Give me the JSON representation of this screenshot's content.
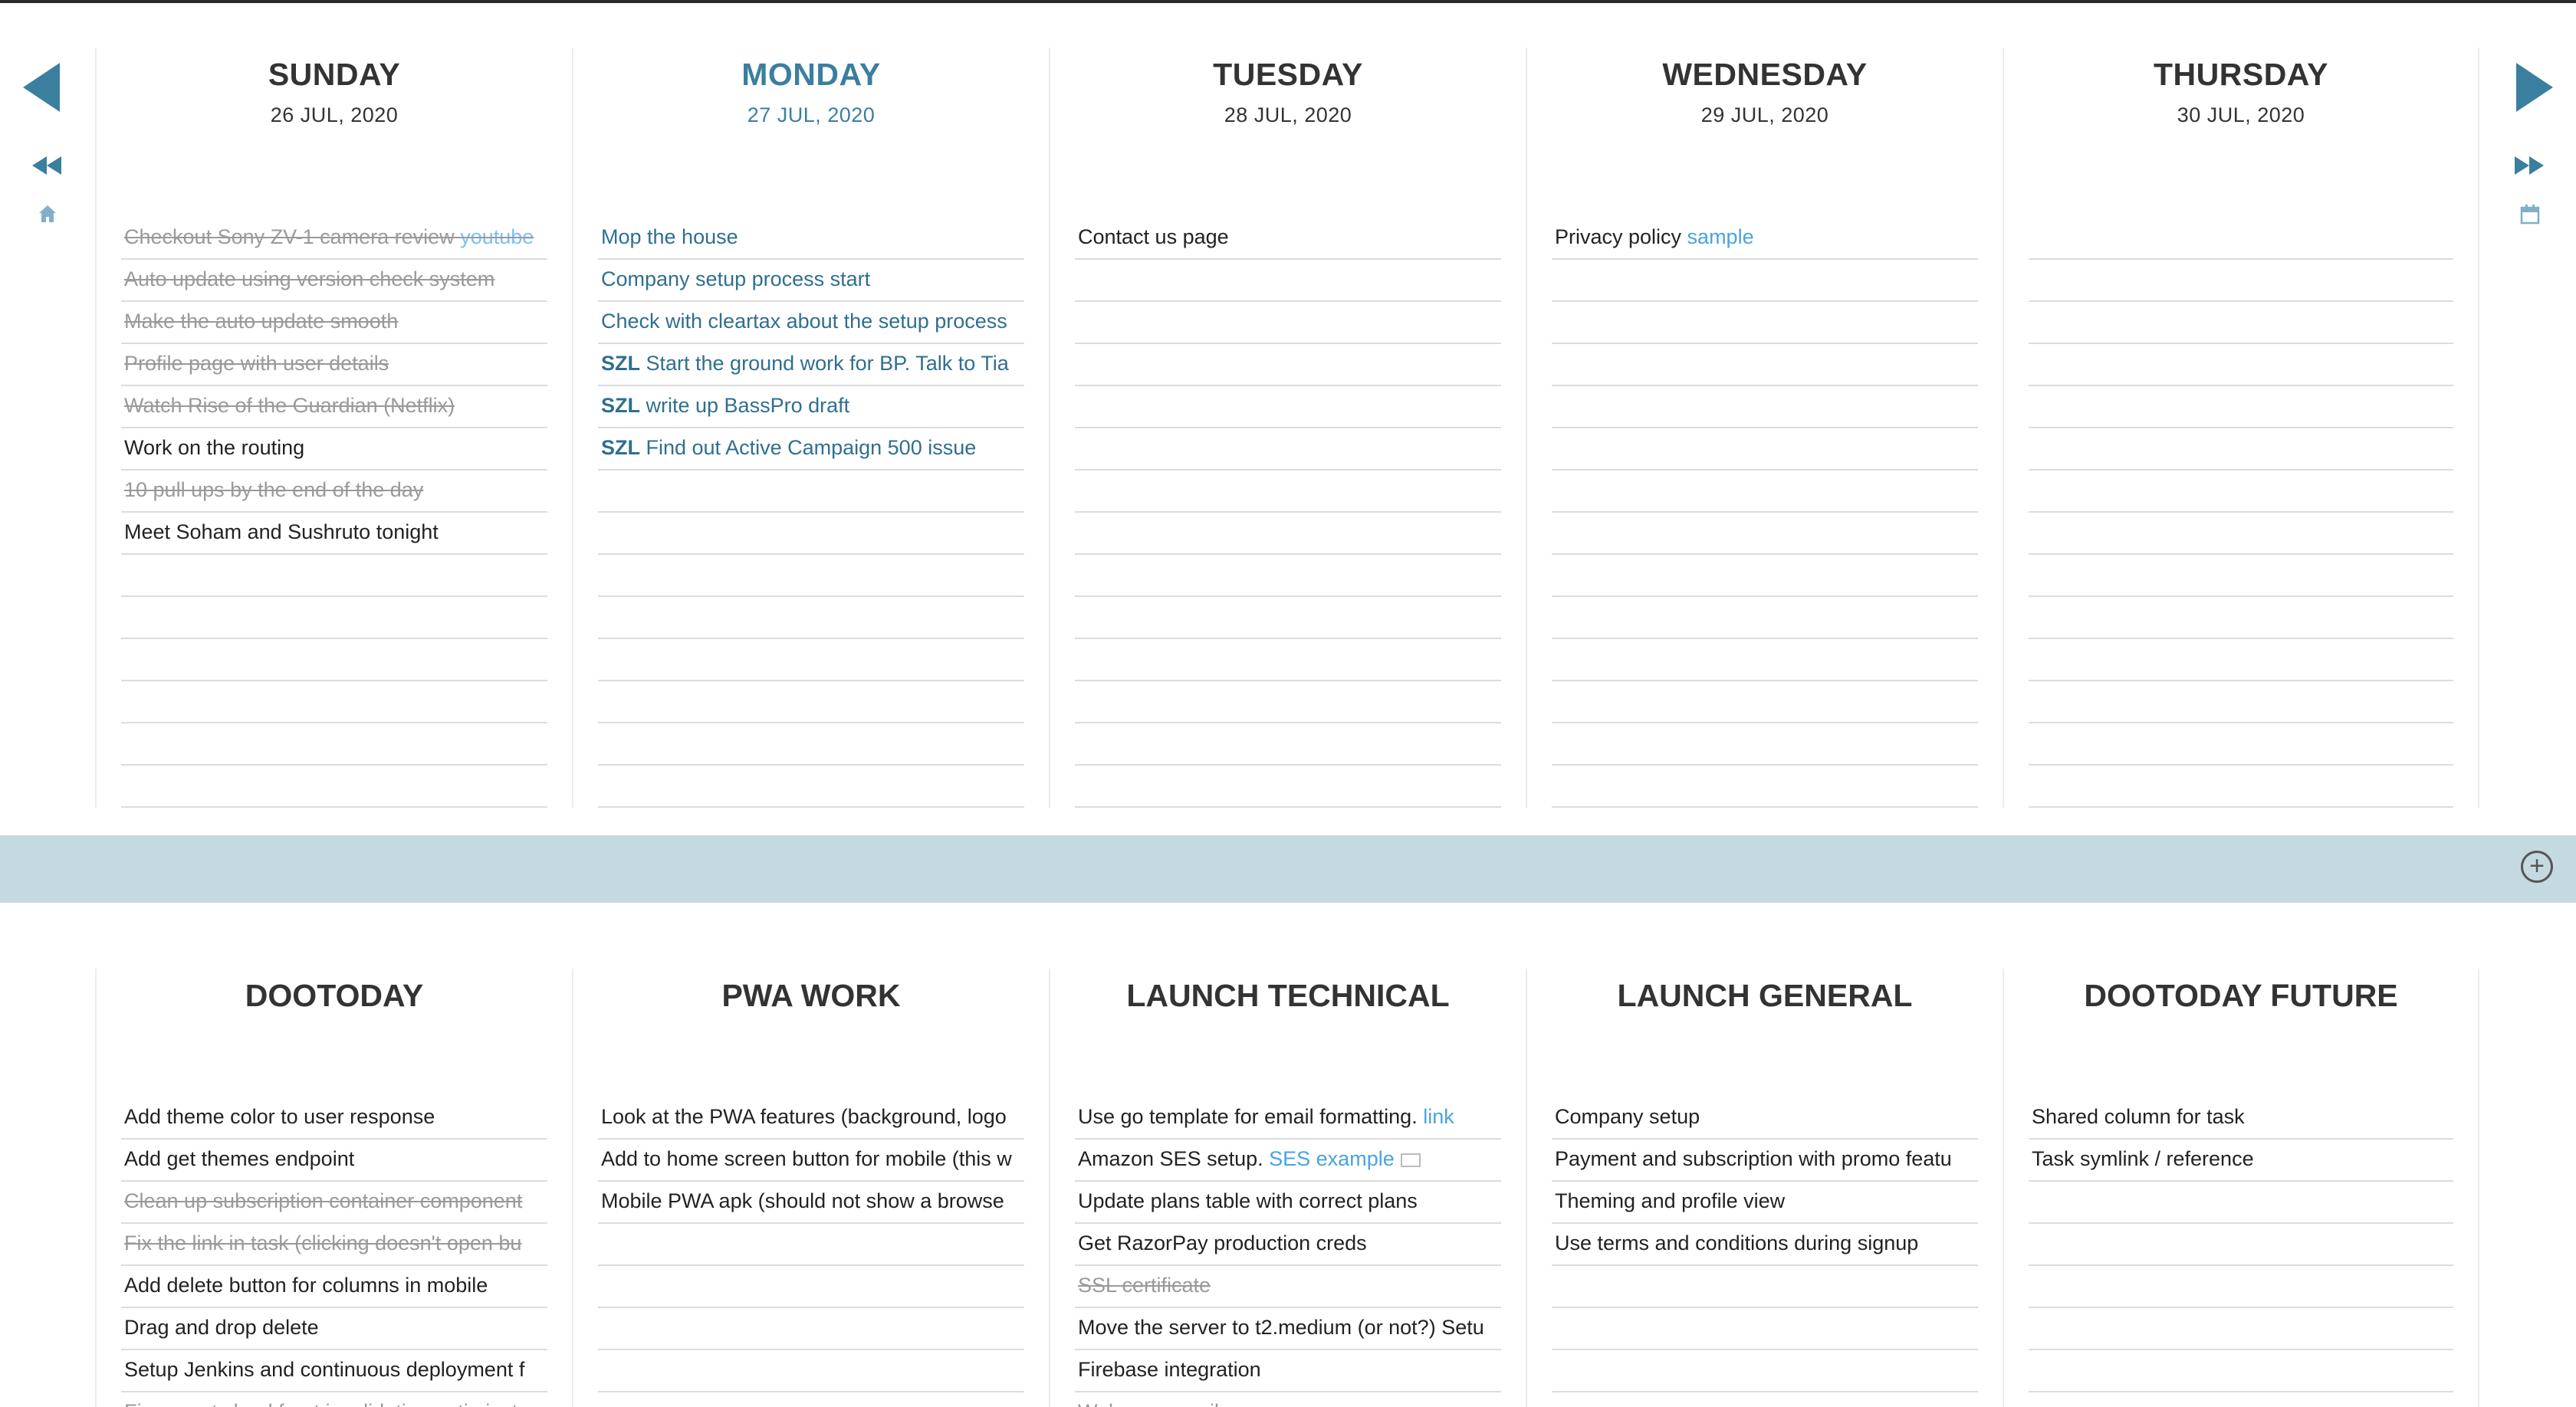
{
  "colors": {
    "accent": "#3a7fa0",
    "band": "#c5d9e0",
    "link": "#4aa3df"
  },
  "nav": {
    "prev_icon": "triangle-left-icon",
    "next_icon": "triangle-right-icon",
    "rewind_icon": "double-chevron-left-icon",
    "fastforward_icon": "double-chevron-right-icon",
    "home_icon": "home-icon",
    "calendar_icon": "calendar-icon"
  },
  "days": [
    {
      "name": "SUNDAY",
      "date": "26 JUL, 2020",
      "today": false,
      "tasks": [
        {
          "text": "Checkout Sony ZV-1 camera review ",
          "link": "youtube",
          "done": true
        },
        {
          "text": "Auto update using version check system",
          "done": true
        },
        {
          "text": "Make the auto update smooth",
          "done": true
        },
        {
          "text": "Profile page with user details",
          "done": true
        },
        {
          "text": "Watch Rise of the Guardian (Netflix)",
          "done": true
        },
        {
          "text": "Work on the routing",
          "done": false
        },
        {
          "text": "10 pull ups by the end of the day",
          "done": true
        },
        {
          "text": "Meet Soham and Sushruto tonight",
          "done": false
        }
      ]
    },
    {
      "name": "MONDAY",
      "date": "27 JUL, 2020",
      "today": true,
      "tasks": [
        {
          "text": "Mop the house",
          "done": false
        },
        {
          "text": "Company setup process start",
          "done": false
        },
        {
          "text": "Check with cleartax about the setup process",
          "done": false
        },
        {
          "prefix": "SZL",
          "text": " Start the ground work for BP. Talk to Tia",
          "done": false
        },
        {
          "prefix": "SZL",
          "text": " write up BassPro draft",
          "done": false
        },
        {
          "prefix": "SZL",
          "text": " Find out Active Campaign 500 issue",
          "done": false
        }
      ]
    },
    {
      "name": "TUESDAY",
      "date": "28 JUL, 2020",
      "today": false,
      "tasks": [
        {
          "text": "Contact us page",
          "done": false
        }
      ]
    },
    {
      "name": "WEDNESDAY",
      "date": "29 JUL, 2020",
      "today": false,
      "tasks": [
        {
          "text": "Privacy policy ",
          "link": "sample",
          "done": false
        }
      ]
    },
    {
      "name": "THURSDAY",
      "date": "30 JUL, 2020",
      "today": false,
      "tasks": []
    }
  ],
  "band": {
    "add_icon": "plus-circle-icon"
  },
  "lists": [
    {
      "name": "DOOTODAY",
      "tasks": [
        {
          "text": "Add theme color to user response",
          "done": false
        },
        {
          "text": "Add get themes endpoint",
          "done": false
        },
        {
          "text": "Clean up subscription container component",
          "done": true
        },
        {
          "text": "Fix the link in task (clicking doesn't open bu",
          "done": true
        },
        {
          "text": "Add delete button for columns in mobile",
          "done": false
        },
        {
          "text": "Drag and drop delete",
          "done": false
        },
        {
          "text": "Setup Jenkins and continuous deployment f",
          "done": false
        },
        {
          "text": "Figure out cloud front invalidation optimizat",
          "done": true
        }
      ]
    },
    {
      "name": "PWA WORK",
      "tasks": [
        {
          "text": "Look at the PWA features (background, logo",
          "done": false
        },
        {
          "text": "Add to home screen button for mobile (this w",
          "done": false
        },
        {
          "text": "Mobile PWA apk (should not show a browse",
          "done": false
        }
      ]
    },
    {
      "name": "LAUNCH TECHNICAL",
      "tasks": [
        {
          "text": "Use go template for email formatting. ",
          "link": "link",
          "done": false
        },
        {
          "text": "Amazon SES setup. ",
          "link": "SES example",
          "mail": true,
          "done": false
        },
        {
          "text": "Update plans table with correct plans",
          "done": false
        },
        {
          "text": "Get RazorPay production creds",
          "done": false
        },
        {
          "text": "SSL certificate",
          "done": true
        },
        {
          "text": "Move the server to t2.medium (or not?) Setu",
          "done": false
        },
        {
          "text": "Firebase integration",
          "done": false
        },
        {
          "text": "Welcome email",
          "done": true
        }
      ]
    },
    {
      "name": "LAUNCH GENERAL",
      "tasks": [
        {
          "text": "Company setup",
          "done": false
        },
        {
          "text": "Payment and subscription with promo featu",
          "done": false
        },
        {
          "text": "Theming and profile view",
          "done": false
        },
        {
          "text": "Use terms and conditions during signup",
          "done": false
        }
      ]
    },
    {
      "name": "DOOTODAY FUTURE",
      "tasks": [
        {
          "text": "Shared column for task",
          "done": false
        },
        {
          "text": "Task symlink / reference",
          "done": false
        }
      ]
    }
  ]
}
